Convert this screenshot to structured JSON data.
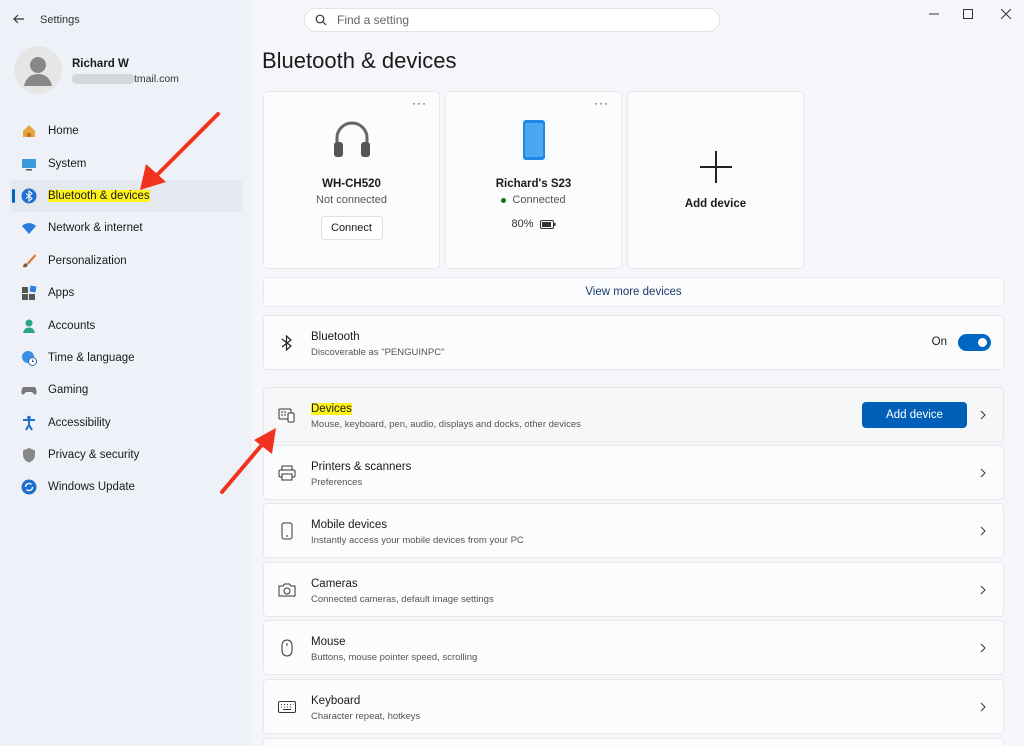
{
  "app": {
    "title": "Settings"
  },
  "search": {
    "placeholder": "Find a setting"
  },
  "user": {
    "name": "Richard W",
    "email_suffix": "tmail.com"
  },
  "nav": {
    "items": [
      {
        "label": "Home",
        "icon": "home-icon"
      },
      {
        "label": "System",
        "icon": "system-icon"
      },
      {
        "label": "Bluetooth & devices",
        "icon": "bluetooth-icon",
        "active": true
      },
      {
        "label": "Network & internet",
        "icon": "wifi-icon"
      },
      {
        "label": "Personalization",
        "icon": "brush-icon"
      },
      {
        "label": "Apps",
        "icon": "apps-icon"
      },
      {
        "label": "Accounts",
        "icon": "person-icon"
      },
      {
        "label": "Time & language",
        "icon": "globe-clock-icon"
      },
      {
        "label": "Gaming",
        "icon": "gamepad-icon"
      },
      {
        "label": "Accessibility",
        "icon": "accessibility-icon"
      },
      {
        "label": "Privacy & security",
        "icon": "shield-icon"
      },
      {
        "label": "Windows Update",
        "icon": "update-icon"
      }
    ]
  },
  "page": {
    "title": "Bluetooth & devices"
  },
  "devices": [
    {
      "name": "WH-CH520",
      "status": "Not connected",
      "action": "Connect",
      "icon": "headphones-icon"
    },
    {
      "name": "Richard's S23",
      "status": "Connected",
      "battery": "80%",
      "icon": "phone-icon"
    }
  ],
  "add_card": {
    "label": "Add device"
  },
  "more": {
    "label": "View more devices",
    "ellipsis": "···"
  },
  "bluetooth": {
    "title": "Bluetooth",
    "subtitle": "Discoverable as \"PENGUINPC\"",
    "state": "On"
  },
  "rows": [
    {
      "title": "Devices",
      "subtitle": "Mouse, keyboard, pen, audio, displays and docks, other devices",
      "button": "Add device",
      "icon": "devices-icon"
    },
    {
      "title": "Printers & scanners",
      "subtitle": "Preferences",
      "icon": "printer-icon"
    },
    {
      "title": "Mobile devices",
      "subtitle": "Instantly access your mobile devices from your PC",
      "icon": "mobile-icon"
    },
    {
      "title": "Cameras",
      "subtitle": "Connected cameras, default image settings",
      "icon": "camera-icon"
    },
    {
      "title": "Mouse",
      "subtitle": "Buttons, mouse pointer speed, scrolling",
      "icon": "mouse-icon"
    },
    {
      "title": "Keyboard",
      "subtitle": "Character repeat, hotkeys",
      "icon": "keyboard-icon"
    }
  ],
  "colors": {
    "accent": "#0067c0",
    "highlight": "#fff21a",
    "arrow": "#f0321e"
  }
}
